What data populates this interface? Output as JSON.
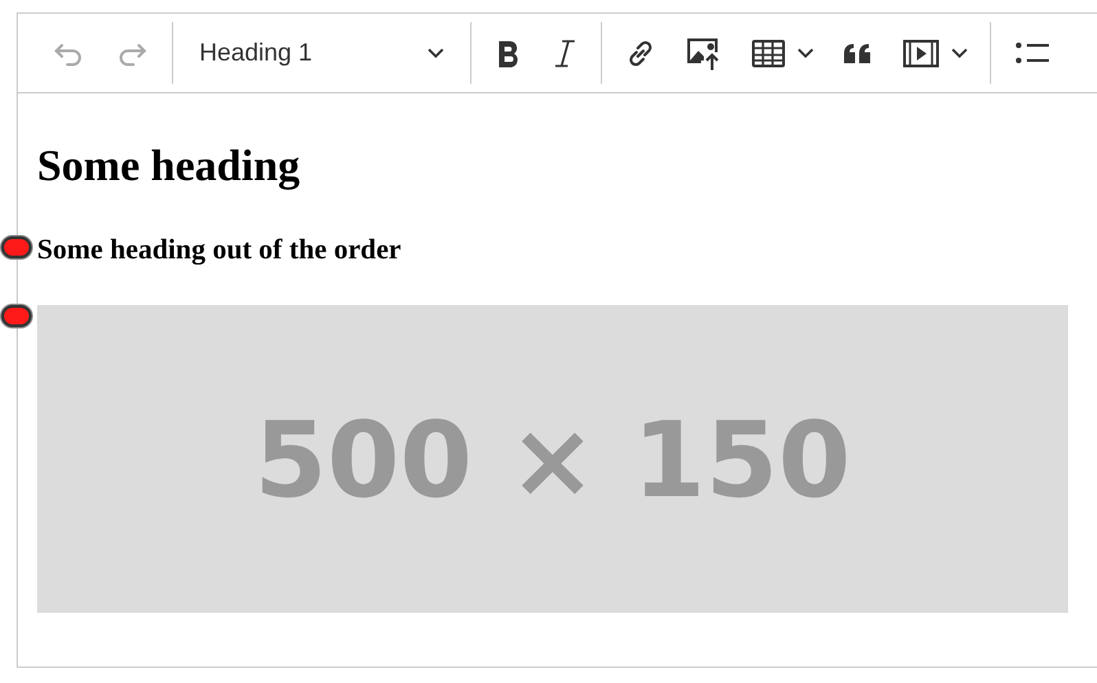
{
  "toolbar": [
    {
      "kind": "undo",
      "disabled": true
    },
    {
      "kind": "redo",
      "disabled": true
    },
    {
      "kind": "separator"
    },
    {
      "kind": "heading-select",
      "value": "Heading 1"
    },
    {
      "kind": "separator"
    },
    {
      "kind": "bold",
      "disabled": false
    },
    {
      "kind": "italic",
      "disabled": false
    },
    {
      "kind": "separator"
    },
    {
      "kind": "link",
      "disabled": false
    },
    {
      "kind": "image-upload",
      "disabled": false
    },
    {
      "kind": "table",
      "disabled": false
    },
    {
      "kind": "quote",
      "disabled": false
    },
    {
      "kind": "media",
      "disabled": false
    },
    {
      "kind": "separator"
    },
    {
      "kind": "bulleted-list",
      "disabled": false
    }
  ],
  "content": [
    {
      "kind": "heading1",
      "text": "Some heading",
      "marked": false
    },
    {
      "kind": "heading3",
      "text": "Some heading out of the order",
      "marked": true
    },
    {
      "kind": "image",
      "text": "500 × 150",
      "marked": true
    }
  ]
}
